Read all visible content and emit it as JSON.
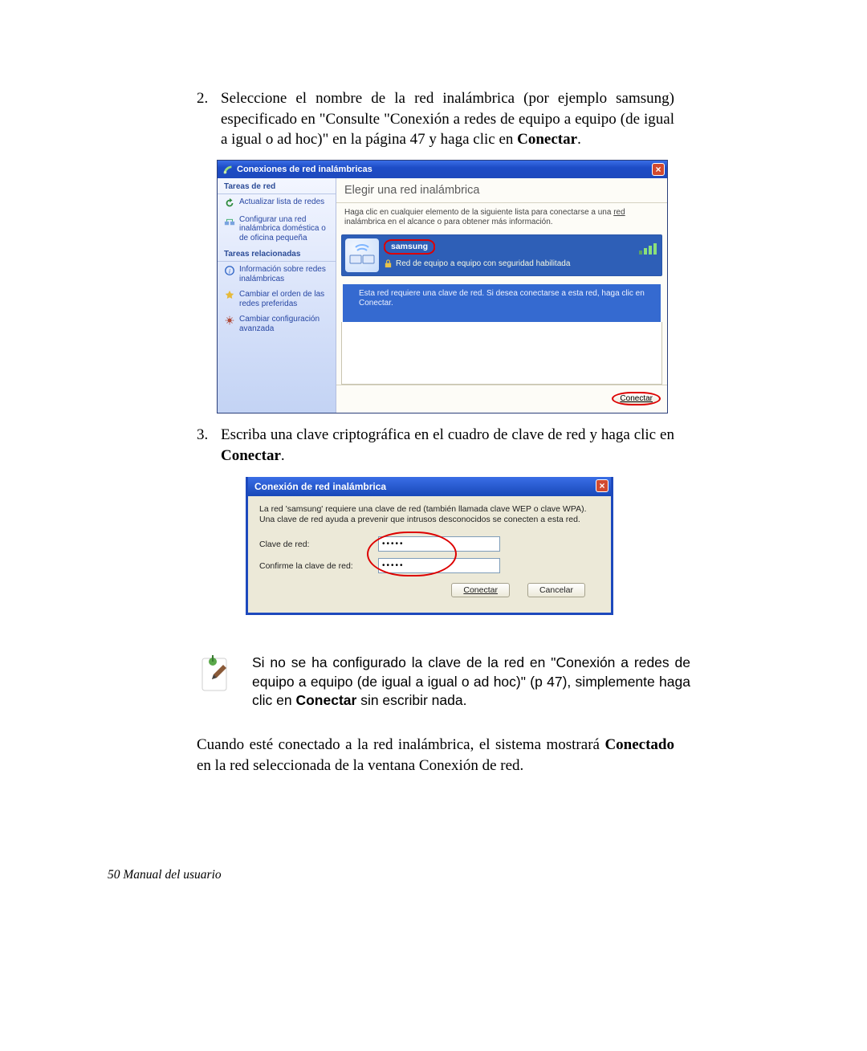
{
  "steps": {
    "s2": {
      "num": "2.",
      "text_a": "Seleccione el nombre de la red inalámbrica (por ejemplo samsung) especificado en \"Consulte \"Conexión a redes de equipo a equipo (de igual a igual o ad hoc)\" en la página 47 y haga clic en ",
      "text_b": "Conectar",
      "text_c": "."
    },
    "s3": {
      "num": "3.",
      "text_a": "Escriba una clave criptográfica en el cuadro de clave de red y haga clic en ",
      "text_b": "Conectar",
      "text_c": "."
    }
  },
  "win1": {
    "title": "Conexiones de red inalámbricas",
    "close": "×",
    "sidebar": {
      "section1": "Tareas de red",
      "item1": "Actualizar lista de redes",
      "item2": "Configurar una red inalámbrica doméstica o de oficina pequeña",
      "section2": "Tareas relacionadas",
      "item3": "Información sobre redes inalámbricas",
      "item4": "Cambiar el orden de las redes preferidas",
      "item5": "Cambiar configuración avanzada"
    },
    "rp": {
      "head": "Elegir una red inalámbrica",
      "sub_a": "Haga clic en cualquier elemento de la siguiente lista para conectarse a una ",
      "sub_b": "red",
      "sub_c": " inalámbrica en el alcance o para obtener más información."
    },
    "net": {
      "name": "samsung",
      "line2": "Red de equipo a equipo con seguridad habilitada",
      "desc": "Esta red requiere una clave de red. Si desea conectarse a esta red, haga clic en Conectar."
    },
    "connect": "Conectar"
  },
  "win2": {
    "title": "Conexión de red inalámbrica",
    "close": "×",
    "desc": "La red 'samsung' requiere una clave de red (también llamada clave WEP o clave WPA). Una clave de red ayuda a prevenir que intrusos desconocidos se conecten a esta red.",
    "label1": "Clave de red:",
    "label2": "Confirme la clave de red:",
    "value1": "•••••",
    "value2": "•••••",
    "btn_connect": "Conectar",
    "btn_cancel": "Cancelar"
  },
  "note": {
    "text_a": "Si no se ha configurado la clave de la red en \"Conexión a redes de equipo a equipo (de igual a igual o ad hoc)\" (p 47), simplemente haga clic en ",
    "text_b": "Conectar",
    "text_c": " sin escribir nada."
  },
  "para_end": {
    "a": "Cuando esté conectado a la red inalámbrica, el sistema mostrará ",
    "b": "Conectado",
    "c": " en la red seleccionada de la ventana Conexión de red."
  },
  "footer": "50  Manual del usuario"
}
